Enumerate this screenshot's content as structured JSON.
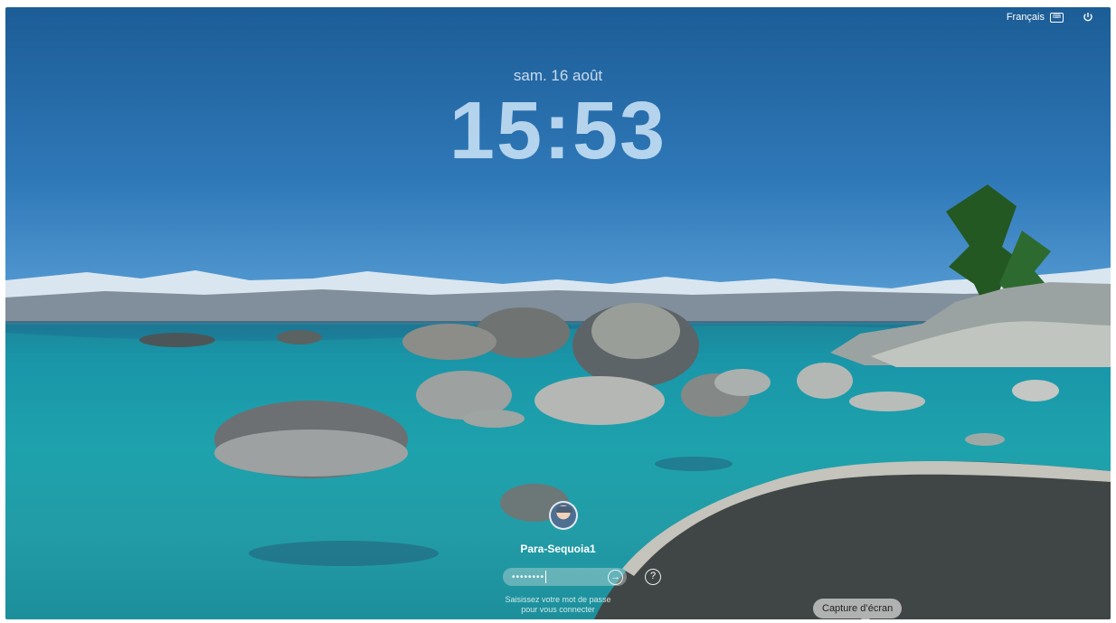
{
  "menubar": {
    "language": "Français",
    "keyboard_icon": "keyboard-layout-icon",
    "power_icon": "power-icon"
  },
  "lock": {
    "date": "sam. 16 août",
    "time": "15:53"
  },
  "login": {
    "username": "Para-Sequoia1",
    "password_masked": "••••••••",
    "hint_line1": "Saisissez votre mot de passe",
    "hint_line2": "pour vous connecter"
  },
  "tooltip": {
    "label": "Capture d’écran"
  },
  "colors": {
    "text": "#ffffff",
    "tooltip_bg": "#dcdcdc"
  }
}
